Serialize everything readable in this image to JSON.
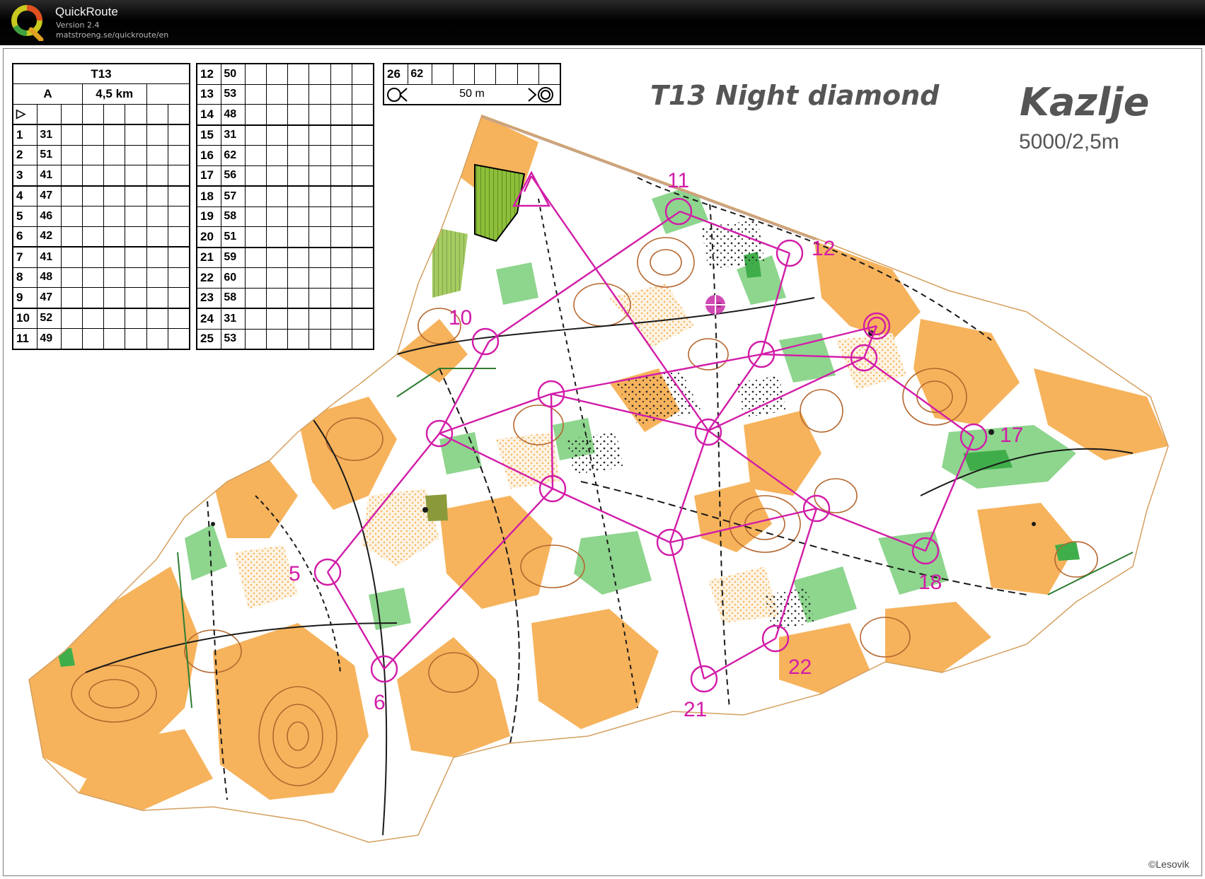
{
  "app": {
    "title": "QuickRoute",
    "version": "Version 2.4",
    "url": "matstroeng.se/quickroute/en"
  },
  "map": {
    "course_title": "T13 Night diamond",
    "map_name": "Kazlje",
    "scale_info": "5000/2,5m",
    "copyright": "©Lesovik",
    "course_color": "#d21ca8",
    "terrain_colors": {
      "open": "#f6b35c",
      "semi_open": "#fbdcaa",
      "vegetation": "#8ed58e",
      "dense": "#3fae4a",
      "contours": "#b5652d"
    }
  },
  "description_card": {
    "header": "T13",
    "class_label": "A",
    "length": "4,5 km",
    "start_symbol": "▷",
    "controls_col1": [
      {
        "num": "1",
        "code": "31"
      },
      {
        "num": "2",
        "code": "51"
      },
      {
        "num": "3",
        "code": "41"
      },
      {
        "num": "4",
        "code": "47"
      },
      {
        "num": "5",
        "code": "46"
      },
      {
        "num": "6",
        "code": "42"
      },
      {
        "num": "7",
        "code": "41"
      },
      {
        "num": "8",
        "code": "48"
      },
      {
        "num": "9",
        "code": "47"
      },
      {
        "num": "10",
        "code": "52"
      },
      {
        "num": "11",
        "code": "49"
      }
    ],
    "controls_col2": [
      {
        "num": "12",
        "code": "50"
      },
      {
        "num": "13",
        "code": "53"
      },
      {
        "num": "14",
        "code": "48"
      },
      {
        "num": "15",
        "code": "31"
      },
      {
        "num": "16",
        "code": "62"
      },
      {
        "num": "17",
        "code": "56"
      },
      {
        "num": "18",
        "code": "57"
      },
      {
        "num": "19",
        "code": "58"
      },
      {
        "num": "20",
        "code": "51"
      },
      {
        "num": "21",
        "code": "59"
      },
      {
        "num": "22",
        "code": "60"
      },
      {
        "num": "23",
        "code": "58"
      },
      {
        "num": "24",
        "code": "31"
      },
      {
        "num": "25",
        "code": "53"
      }
    ],
    "controls_col3": [
      {
        "num": "26",
        "code": "62"
      }
    ],
    "finish_distance": "50 m"
  },
  "control_labels": [
    "5",
    "6",
    "10",
    "11",
    "12",
    "17",
    "18",
    "21",
    "22"
  ]
}
